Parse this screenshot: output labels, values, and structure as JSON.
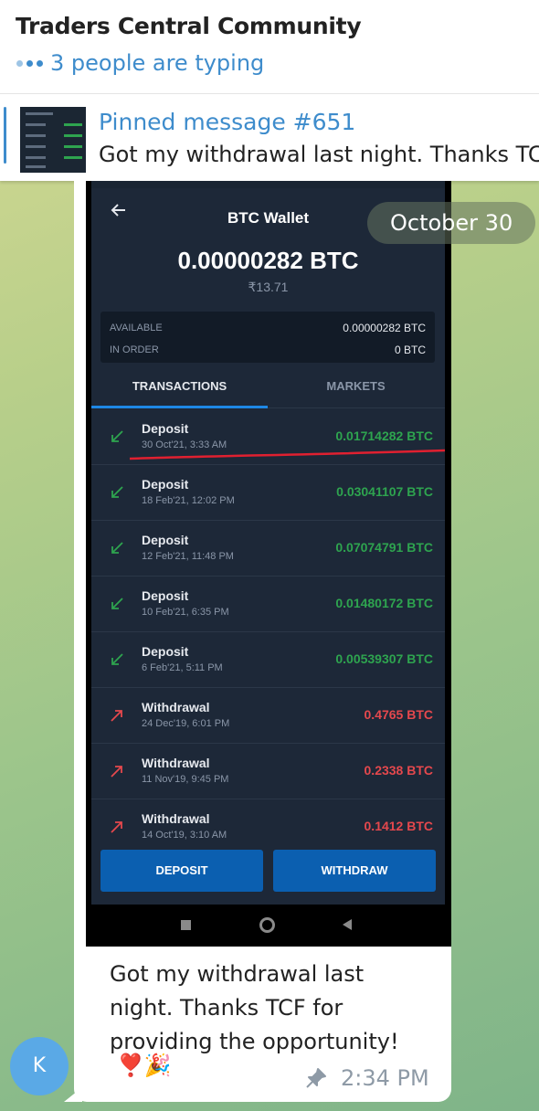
{
  "header": {
    "title": "Traders Central Community",
    "typing": "3 people are typing"
  },
  "pinned": {
    "title": "Pinned message #651",
    "text": "Got my withdrawal last night. Thanks TC"
  },
  "date_badge": "October 30",
  "wallet": {
    "title": "BTC Wallet",
    "balance": "0.00000282 BTC",
    "fiat": "₹13.71",
    "available_label": "AVAILABLE",
    "available_value": "0.00000282 BTC",
    "in_order_label": "IN ORDER",
    "in_order_value": "0 BTC",
    "tab_transactions": "TRANSACTIONS",
    "tab_markets": "MARKETS",
    "deposit_button": "DEPOSIT",
    "withdraw_button": "WITHDRAW",
    "transactions": [
      {
        "type": "Deposit",
        "date": "30 Oct'21, 3:33 AM",
        "amount": "0.01714282 BTC"
      },
      {
        "type": "Deposit",
        "date": "18 Feb'21, 12:02 PM",
        "amount": "0.03041107 BTC"
      },
      {
        "type": "Deposit",
        "date": "12 Feb'21, 11:48 PM",
        "amount": "0.07074791 BTC"
      },
      {
        "type": "Deposit",
        "date": "10 Feb'21, 6:35 PM",
        "amount": "0.01480172 BTC"
      },
      {
        "type": "Deposit",
        "date": "6 Feb'21, 5:11 PM",
        "amount": "0.00539307 BTC"
      },
      {
        "type": "Withdrawal",
        "date": "24 Dec'19, 6:01 PM",
        "amount": "0.4765 BTC"
      },
      {
        "type": "Withdrawal",
        "date": "11 Nov'19, 9:45 PM",
        "amount": "0.2338 BTC"
      },
      {
        "type": "Withdrawal",
        "date": "14 Oct'19, 3:10 AM",
        "amount": "0.1412 BTC"
      }
    ]
  },
  "message": {
    "line1": "Got my withdrawal last",
    "line2": "night. Thanks TCF for",
    "line3": "providing the opportunity!",
    "emojis": "❣️🎉",
    "time": "2:34 PM"
  },
  "avatar_letter": "K",
  "colors": {
    "accent": "#3e8ccc",
    "deposit_green": "#2ea44f",
    "withdraw_red": "#e5484d",
    "wallet_bg": "#1d2838",
    "button_blue": "#0b5fb0"
  }
}
